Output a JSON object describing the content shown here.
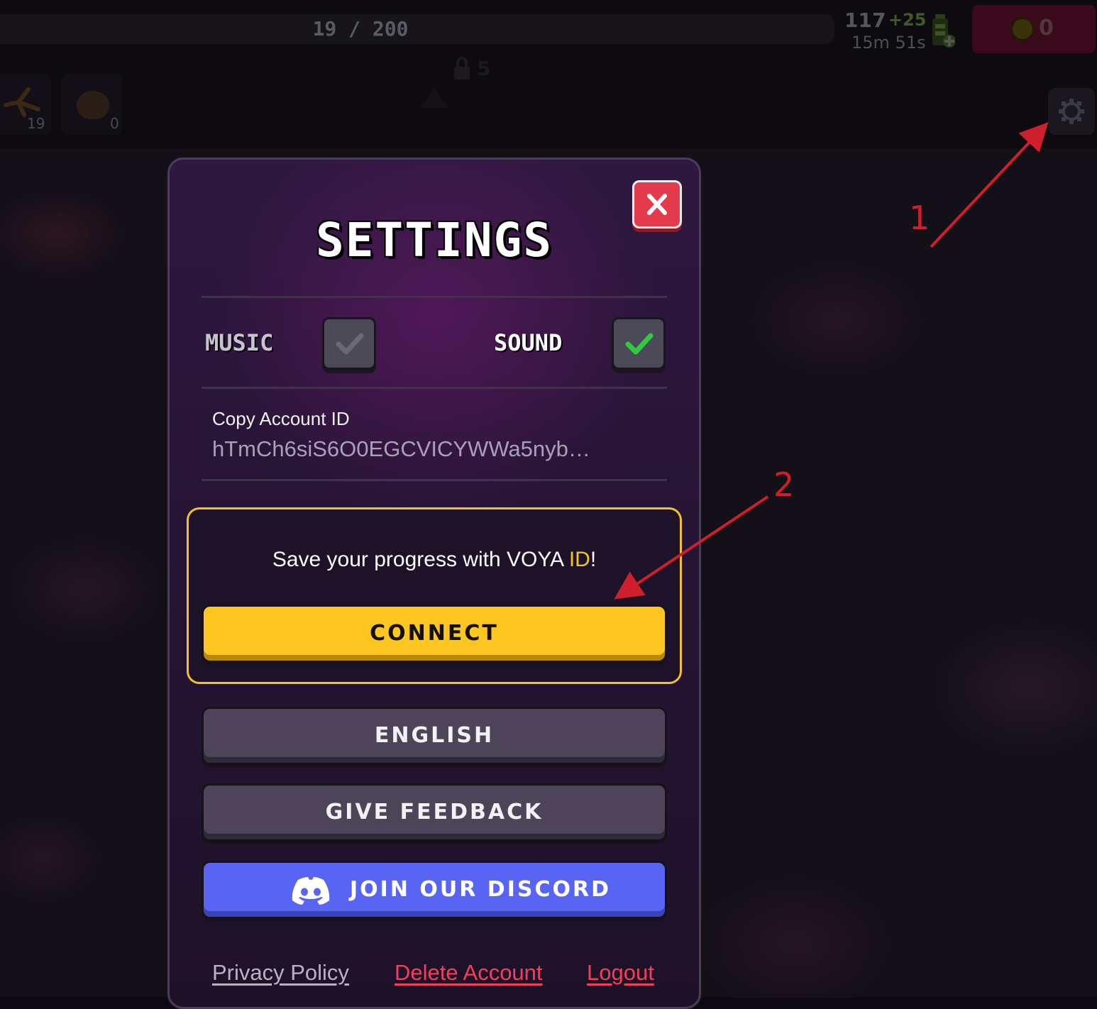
{
  "hud": {
    "xp_text": "19 / 200",
    "energy_value": "117",
    "energy_bonus": "+25",
    "energy_timer": "15m 51s",
    "coins": "0",
    "inventory": [
      {
        "icon": "stick-icon",
        "count": "19"
      },
      {
        "icon": "rock-icon",
        "count": "0"
      }
    ],
    "lock_level": "5"
  },
  "annotations": {
    "label_1": "1",
    "label_2": "2",
    "color": "#cf1f2c"
  },
  "settings": {
    "title": "SETTINGS",
    "music_label": "MUSIC",
    "music_enabled": false,
    "sound_label": "SOUND",
    "sound_enabled": true,
    "copy_account_label": "Copy Account ID",
    "account_id": "hTmCh6siS6O0EGCVICYWWa5nyb…",
    "voya_prompt_prefix": "Save your progress with VOYA ",
    "voya_prompt_id": "ID",
    "voya_prompt_suffix": "!",
    "connect_label": "CONNECT",
    "language_label": "ENGLISH",
    "feedback_label": "GIVE FEEDBACK",
    "discord_label": "JOIN OUR DISCORD",
    "privacy_label": "Privacy Policy",
    "delete_label": "Delete Account",
    "logout_label": "Logout"
  },
  "colors": {
    "connect": "#fdc621",
    "discord": "#5865f2",
    "close": "#e33a4d",
    "danger_link": "#f0405a",
    "check_on": "#2ecc40"
  }
}
